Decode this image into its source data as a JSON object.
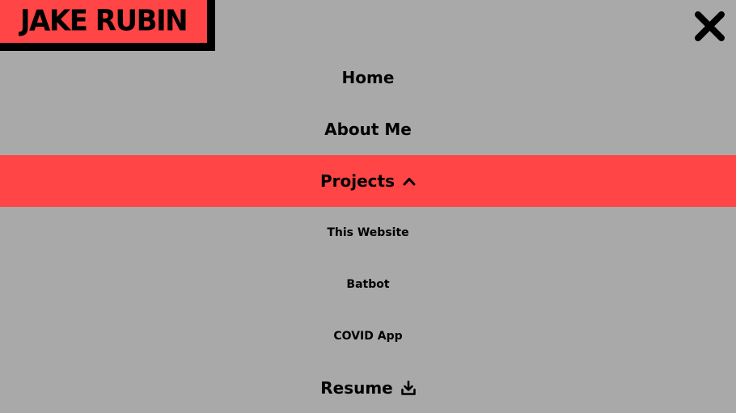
{
  "logo": {
    "text": "JAKE RUBIN"
  },
  "close_button": {
    "icon": "close-icon"
  },
  "colors": {
    "background": "#a9a9a9",
    "accent": "#ff4545",
    "text": "#000000"
  },
  "nav": {
    "items": [
      {
        "label": "Home"
      },
      {
        "label": "About Me"
      },
      {
        "label": "Projects",
        "icon": "chevron-up-icon",
        "expanded": true
      },
      {
        "label": "This Website"
      },
      {
        "label": "Batbot"
      },
      {
        "label": "COVID App"
      },
      {
        "label": "Resume",
        "icon": "download-icon"
      }
    ]
  }
}
